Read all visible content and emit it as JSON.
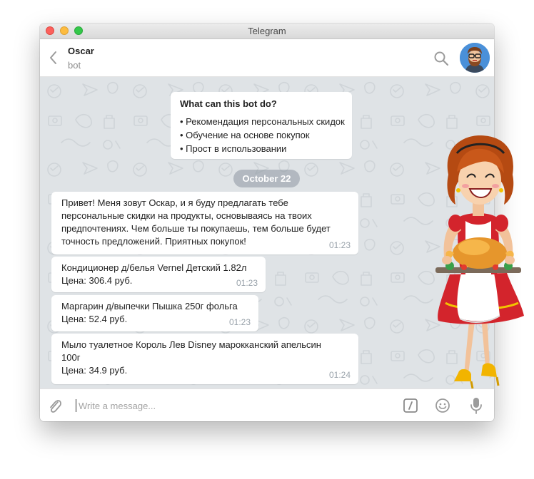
{
  "window": {
    "title": "Telegram"
  },
  "header": {
    "name": "Oscar",
    "subtitle": "bot"
  },
  "info_card": {
    "title": "What can this bot do?",
    "items": [
      "Рекомендация персональных скидок",
      "Обучение на основе покупок",
      "Прост в использовании"
    ]
  },
  "date_separator": "October 22",
  "messages": [
    {
      "text": "Привет! Меня зовут Оскар, и я буду предлагать тебе\nперсональные скидки на продукты, основываясь на твоих\nпредпочтениях. Чем больше ты покупаешь, тем больше будет\nточность предложений. Приятных покупок!",
      "time": "01:23"
    },
    {
      "text": "Кондиционер д/белья Vernel Детский 1.82л\nЦена: 306.4 руб.",
      "time": "01:23"
    },
    {
      "text": "Маргарин д/выпечки Пышка 250г фольга\nЦена: 52.4 руб.",
      "time": "01:23"
    },
    {
      "text": "Мыло туалетное Король Лев Disney марокканский апельсин\n100г\nЦена: 34.9 руб.",
      "time": "01:24"
    }
  ],
  "composer": {
    "placeholder": "Write a message...",
    "value": ""
  },
  "icons": {
    "back": "chevron-left-icon",
    "search": "search-icon",
    "attach": "paperclip-icon",
    "commands": "slash-commands-icon",
    "emoji": "emoji-icon",
    "mic": "microphone-icon"
  },
  "colors": {
    "chat_background": "#dfe3e6",
    "bubble": "#ffffff",
    "avatar": "#4a90d9",
    "date_pill": "#9aa4ad",
    "icon_gray": "#9b9b9b"
  }
}
